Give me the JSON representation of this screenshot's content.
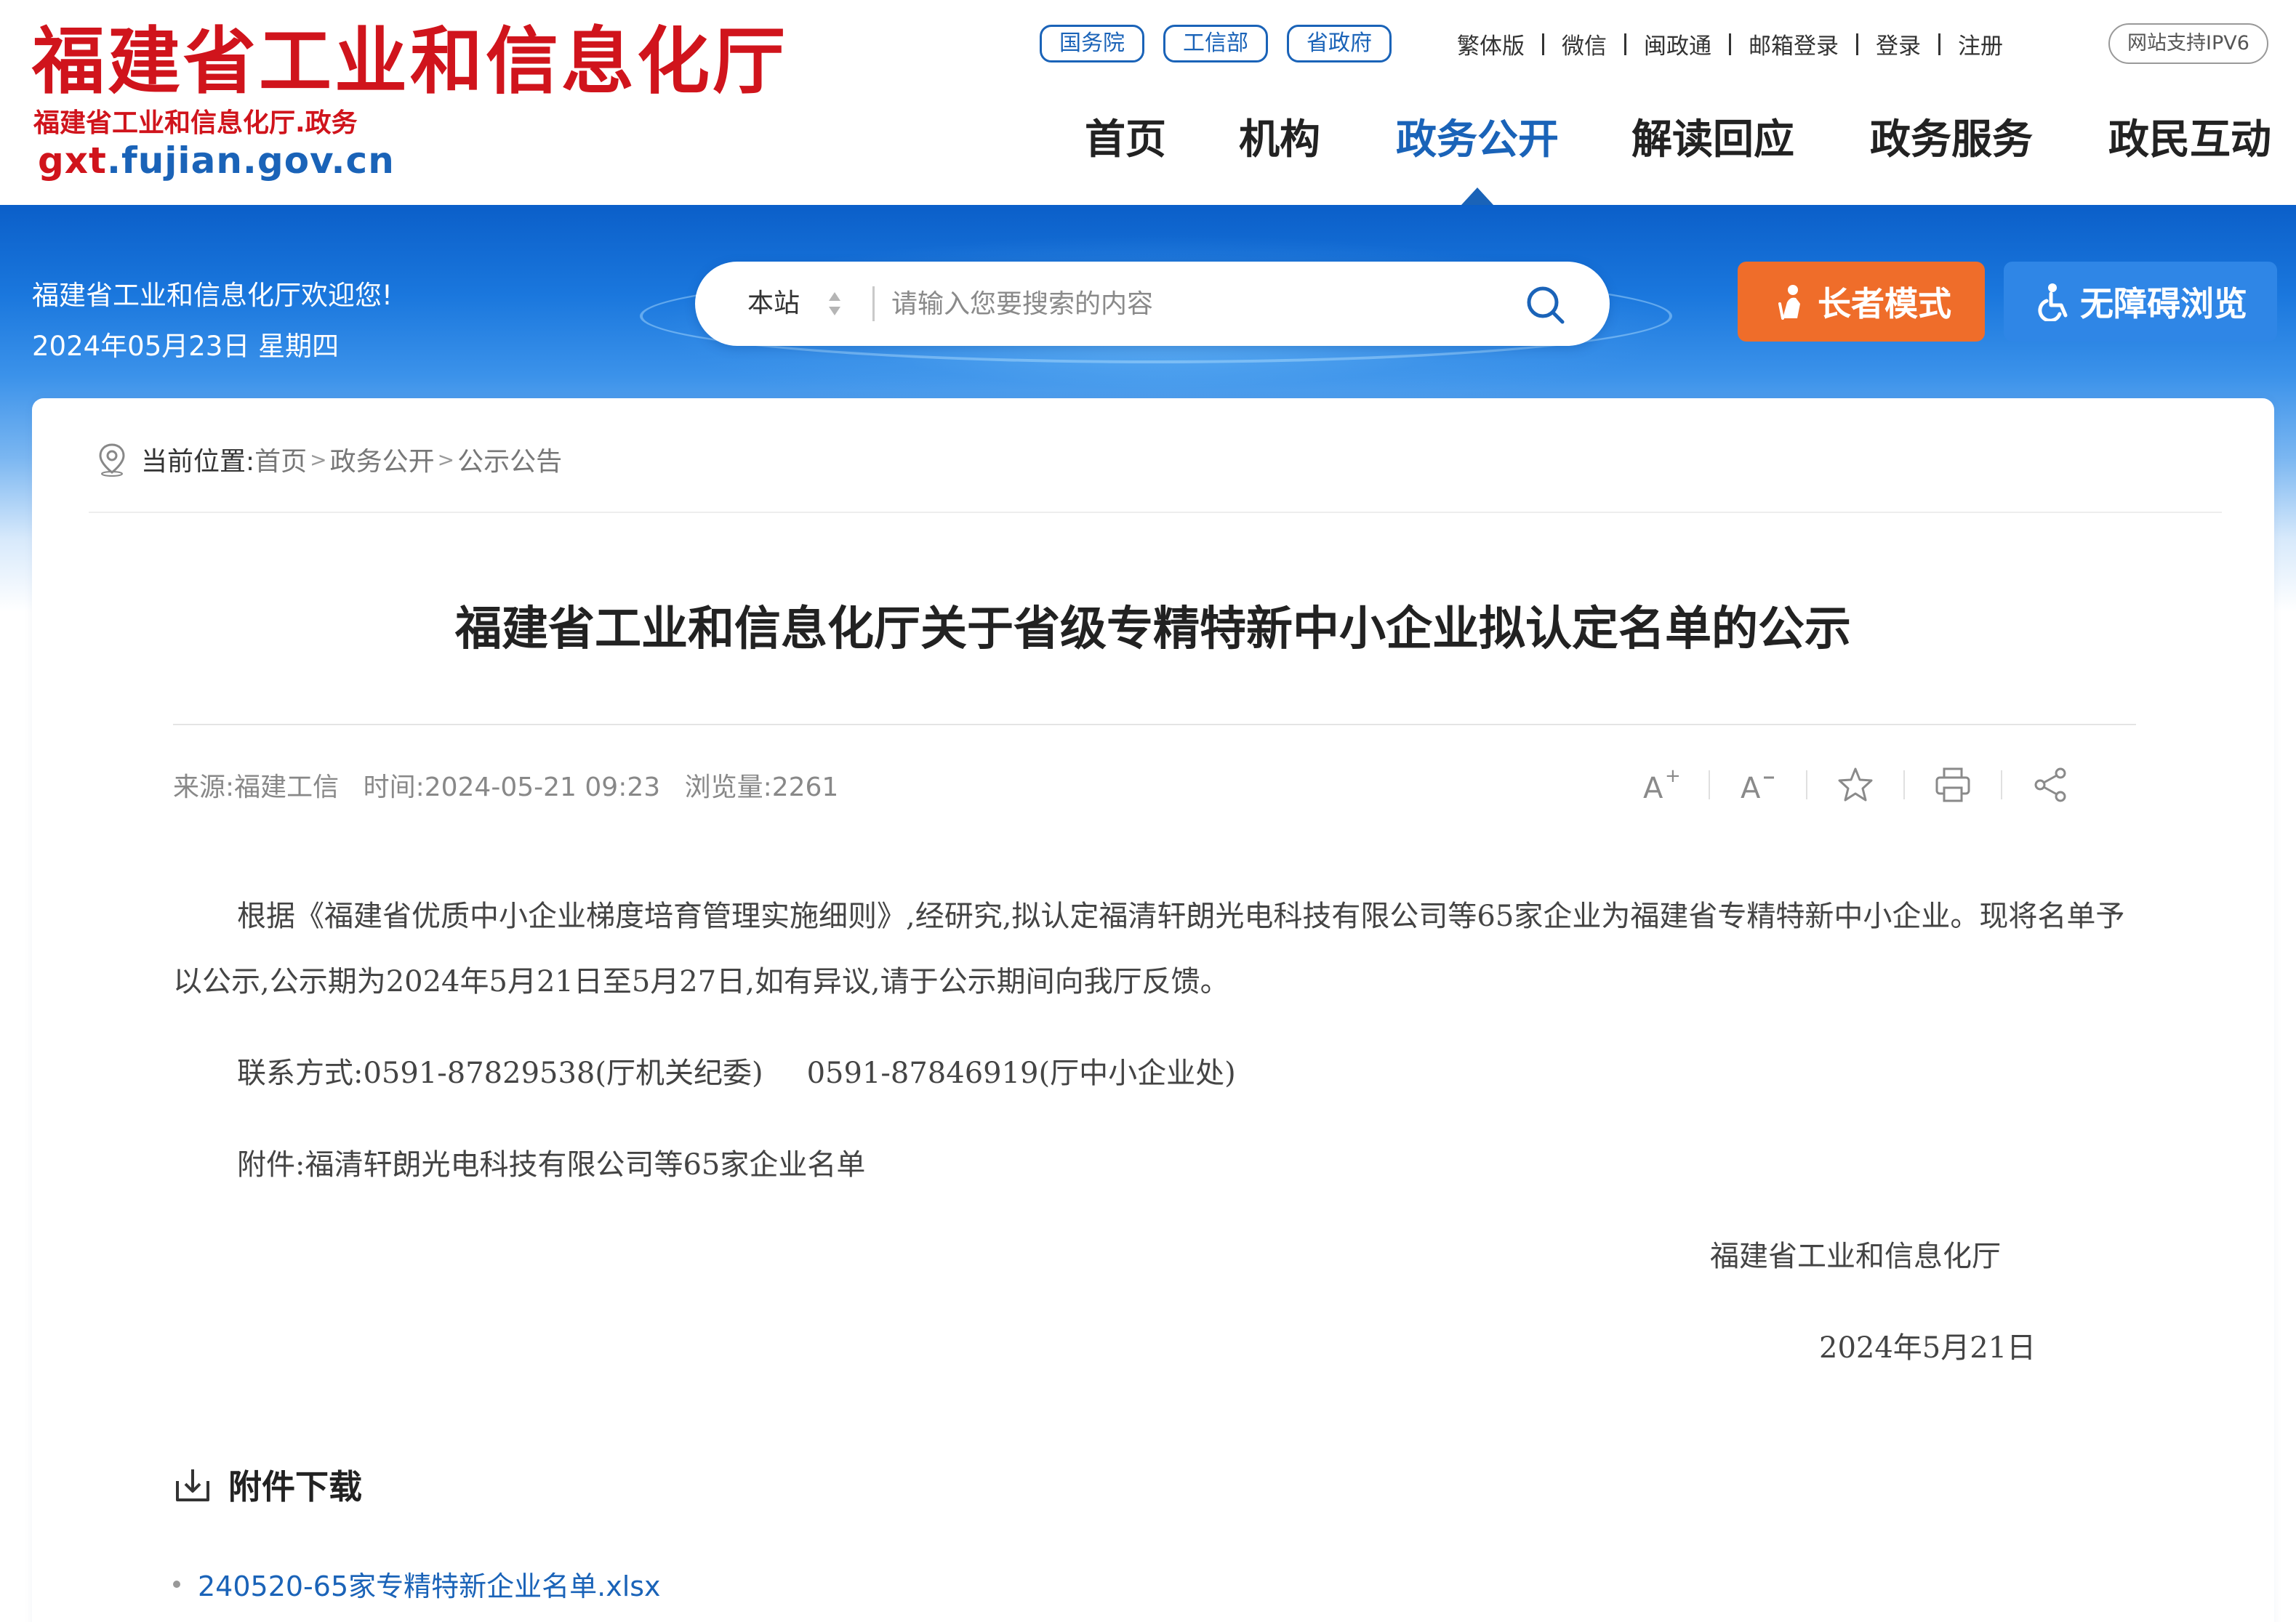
{
  "header": {
    "site_title": "福建省工业和信息化厅",
    "site_subtitle": "福建省工业和信息化厅.政务",
    "domain_prefix": "gxt",
    "domain_suffix": ".fujian.gov.cn",
    "pill_links": [
      "国务院",
      "工信部",
      "省政府"
    ],
    "util_links": [
      "繁体版",
      "微信",
      "闽政通",
      "邮箱登录",
      "登录",
      "注册"
    ],
    "ipv6_badge": "网站支持IPV6",
    "nav": [
      "首页",
      "机构",
      "政务公开",
      "解读回应",
      "政务服务",
      "政民互动"
    ],
    "active_nav": "政务公开",
    "accent_color": "#1a63b8",
    "brand_red": "#d0141c"
  },
  "banner": {
    "welcome": "福建省工业和信息化厅欢迎您!",
    "date": "2024年05月23日  星期四",
    "search_scope": "本站",
    "search_placeholder": "请输入您要搜索的内容",
    "elder_mode": "长者模式",
    "accessible_mode": "无障碍浏览",
    "elder_color": "#ef6d2a",
    "accessible_color": "#2f86e6"
  },
  "breadcrumb": {
    "label": "当前位置:",
    "items": [
      "首页",
      "政务公开",
      "公示公告"
    ]
  },
  "article": {
    "title": "福建省工业和信息化厅关于省级专精特新中小企业拟认定名单的公示",
    "source": "来源:福建工信",
    "time": "时间:2024-05-21 09:23",
    "views": "浏览量:2261",
    "tools": [
      "font-increase-icon",
      "font-decrease-icon",
      "star-icon",
      "print-icon",
      "share-icon"
    ],
    "paragraph": "根据《福建省优质中小企业梯度培育管理实施细则》,经研究,拟认定福清轩朗光电科技有限公司等65家企业为福建省专精特新中小企业。现将名单予以公示,公示期为2024年5月21日至5月27日,如有异议,请于公示期间向我厅反馈。",
    "contact_label": "联系方式:0591-87829538(厅机关纪委)",
    "contact_second": "0591-87846919(厅中小企业处)",
    "attachment_line": "附件:福清轩朗光电科技有限公司等65家企业名单",
    "signoff_org": "福建省工业和信息化厅",
    "signoff_date": "2024年5月21日"
  },
  "downloads": {
    "heading": "附件下载",
    "files": [
      "240520-65家专精特新企业名单.xlsx"
    ]
  }
}
